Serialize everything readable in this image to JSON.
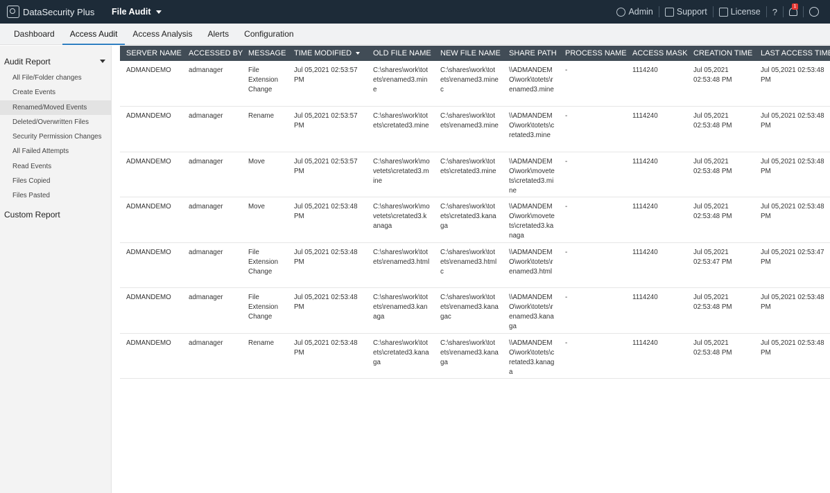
{
  "app": {
    "name": "DataSecurity Plus",
    "module": "File Audit"
  },
  "topbar": {
    "admin": "Admin",
    "support": "Support",
    "license": "License",
    "help": "?",
    "notification_count": "1"
  },
  "nav": {
    "tabs": [
      "Dashboard",
      "Access Audit",
      "Access Analysis",
      "Alerts",
      "Configuration"
    ],
    "active": "Access Audit"
  },
  "sidebar": {
    "audit_report_title": "Audit Report",
    "items": [
      "All File/Folder changes",
      "Create Events",
      "Renamed/Moved Events",
      "Deleted/Overwritten Files",
      "Security Permission Changes",
      "All Failed Attempts",
      "Read Events",
      "Files Copied",
      "Files Pasted"
    ],
    "active_item": "Renamed/Moved Events",
    "custom_report_title": "Custom Report"
  },
  "table": {
    "columns": [
      "SERVER NAME",
      "ACCESSED BY",
      "MESSAGE",
      "TIME MODIFIED",
      "OLD FILE NAME",
      "NEW FILE NAME",
      "SHARE PATH",
      "PROCESS NAME",
      "ACCESS MASK",
      "CREATION TIME",
      "LAST ACCESS TIME"
    ],
    "sorted_column": "TIME MODIFIED",
    "rows": [
      [
        "ADMANDEMO",
        "admanager",
        "File Extension Change",
        "Jul 05,2021 02:53:57 PM",
        "C:\\shares\\work\\totets\\renamed3.mine",
        "C:\\shares\\work\\totets\\renamed3.minec",
        "\\\\ADMANDEMO\\work\\totets\\renamed3.mine",
        "-",
        "1114240",
        "Jul 05,2021 02:53:48 PM",
        "Jul 05,2021 02:53:48 PM"
      ],
      [
        "ADMANDEMO",
        "admanager",
        "Rename",
        "Jul 05,2021 02:53:57 PM",
        "C:\\shares\\work\\totets\\cretated3.mine",
        "C:\\shares\\work\\totets\\renamed3.mine",
        "\\\\ADMANDEMO\\work\\totets\\cretated3.mine",
        "-",
        "1114240",
        "Jul 05,2021 02:53:48 PM",
        "Jul 05,2021 02:53:48 PM"
      ],
      [
        "ADMANDEMO",
        "admanager",
        "Move",
        "Jul 05,2021 02:53:57 PM",
        "C:\\shares\\work\\movetets\\cretated3.mine",
        "C:\\shares\\work\\totets\\cretated3.mine",
        "\\\\ADMANDEMO\\work\\movetets\\cretated3.mine",
        "-",
        "1114240",
        "Jul 05,2021 02:53:48 PM",
        "Jul 05,2021 02:53:48 PM"
      ],
      [
        "ADMANDEMO",
        "admanager",
        "Move",
        "Jul 05,2021 02:53:48 PM",
        "C:\\shares\\work\\movetets\\cretated3.kanaga",
        "C:\\shares\\work\\totets\\cretated3.kanaga",
        "\\\\ADMANDEMO\\work\\movetets\\cretated3.kanaga",
        "-",
        "1114240",
        "Jul 05,2021 02:53:48 PM",
        "Jul 05,2021 02:53:48 PM"
      ],
      [
        "ADMANDEMO",
        "admanager",
        "File Extension Change",
        "Jul 05,2021 02:53:48 PM",
        "C:\\shares\\work\\totets\\renamed3.html",
        "C:\\shares\\work\\totets\\renamed3.htmlc",
        "\\\\ADMANDEMO\\work\\totets\\renamed3.html",
        "-",
        "1114240",
        "Jul 05,2021 02:53:47 PM",
        "Jul 05,2021 02:53:47 PM"
      ],
      [
        "ADMANDEMO",
        "admanager",
        "File Extension Change",
        "Jul 05,2021 02:53:48 PM",
        "C:\\shares\\work\\totets\\renamed3.kanaga",
        "C:\\shares\\work\\totets\\renamed3.kanagac",
        "\\\\ADMANDEMO\\work\\totets\\renamed3.kanaga",
        "-",
        "1114240",
        "Jul 05,2021 02:53:48 PM",
        "Jul 05,2021 02:53:48 PM"
      ],
      [
        "ADMANDEMO",
        "admanager",
        "Rename",
        "Jul 05,2021 02:53:48 PM",
        "C:\\shares\\work\\totets\\cretated3.kanaga",
        "C:\\shares\\work\\totets\\renamed3.kanaga",
        "\\\\ADMANDEMO\\work\\totets\\cretated3.kanaga",
        "-",
        "1114240",
        "Jul 05,2021 02:53:48 PM",
        "Jul 05,2021 02:53:48 PM"
      ]
    ]
  },
  "colors": {
    "topbar_bg": "#1d2b38",
    "header_bg": "#414c56",
    "accent": "#2f7fc1"
  }
}
